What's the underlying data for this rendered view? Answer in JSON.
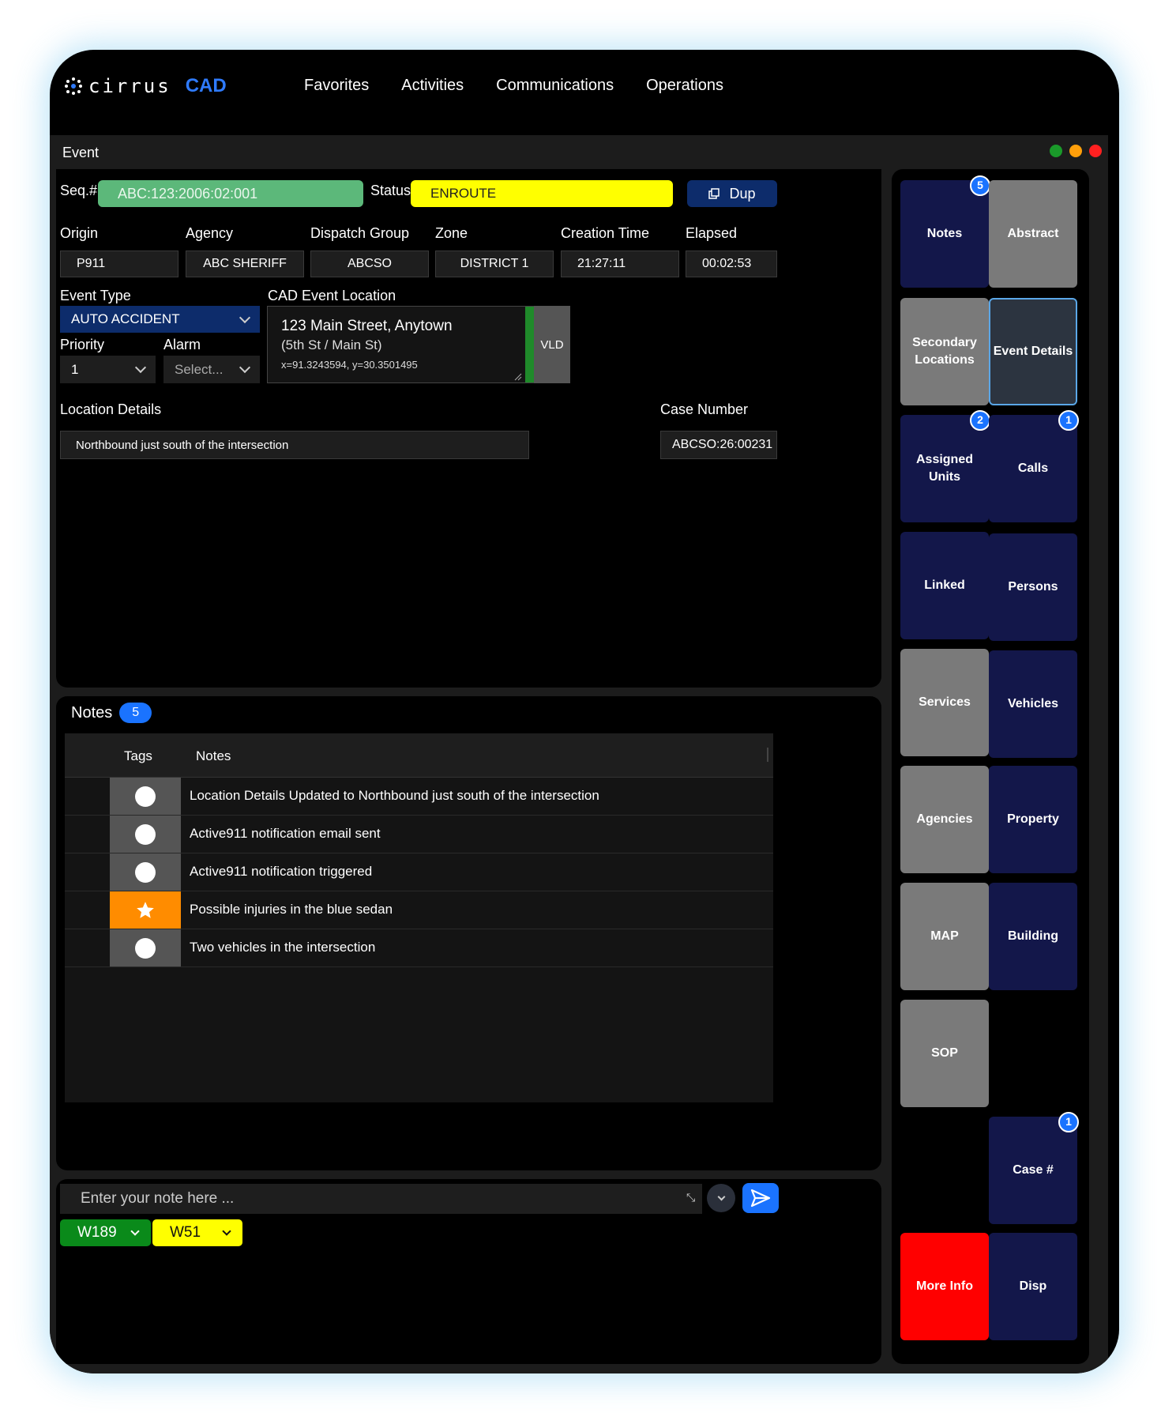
{
  "app": {
    "logo_text": "cirrus",
    "logo_product": "CAD"
  },
  "nav": {
    "items": [
      "Favorites",
      "Activities",
      "Communications",
      "Operations"
    ]
  },
  "window": {
    "title": "Event"
  },
  "event": {
    "seq_label": "Seq.#",
    "seq_value": "ABC:123:2006:02:001",
    "status_label": "Status",
    "status_value": "ENROUTE",
    "dup_label": "Dup",
    "fields": [
      {
        "label": "Origin",
        "value": "P911"
      },
      {
        "label": "Agency",
        "value": "ABC SHERIFF"
      },
      {
        "label": "Dispatch Group",
        "value": "ABCSO"
      },
      {
        "label": "Zone",
        "value": "DISTRICT 1"
      },
      {
        "label": "Creation Time",
        "value": "21:27:11"
      },
      {
        "label": "Elapsed",
        "value": "00:02:53"
      }
    ],
    "event_type_label": "Event Type",
    "event_type_value": "AUTO ACCIDENT",
    "priority_label": "Priority",
    "priority_value": "1",
    "alarm_label": "Alarm",
    "alarm_placeholder": "Select...",
    "location_label": "CAD Event Location",
    "location_line1": "123 Main Street, Anytown",
    "location_line2": "(5th St / Main St)",
    "location_coords": "x=91.3243594, y=30.3501495",
    "vld_label": "VLD",
    "location_details_label": "Location Details",
    "location_details_value": "Northbound just south of the intersection",
    "case_number_label": "Case Number",
    "case_number_value": "ABCSO:26:00231"
  },
  "notes": {
    "title": "Notes",
    "count": "5",
    "col_tags": "Tags",
    "col_notes": "Notes",
    "rows": [
      {
        "tag": "circle",
        "text": "Location Details Updated to Northbound just south of the intersection"
      },
      {
        "tag": "circle",
        "text": "Active911 notification email sent"
      },
      {
        "tag": "circle",
        "text": "Active911 notification triggered"
      },
      {
        "tag": "star",
        "text": "Possible injuries in the blue sedan"
      },
      {
        "tag": "circle",
        "text": "Two vehicles in the intersection"
      }
    ]
  },
  "note_input": {
    "placeholder": "Enter your note here ...",
    "units": [
      {
        "label": "W189",
        "color": "#0a8a1a"
      },
      {
        "label": "W51",
        "color": "#ffff00"
      }
    ]
  },
  "side": {
    "notes": "Notes",
    "notes_badge": "5",
    "abstract": "Abstract",
    "secondary_line1": "Secondary",
    "secondary_line2": "Locations",
    "event_details": "Event Details",
    "assigned_line1": "Assigned",
    "assigned_line2": "Units",
    "assigned_badge": "2",
    "calls": "Calls",
    "calls_badge": "1",
    "linked": "Linked",
    "persons": "Persons",
    "services": "Services",
    "vehicles": "Vehicles",
    "agencies": "Agencies",
    "property": "Property",
    "map": "MAP",
    "building": "Building",
    "sop": "SOP",
    "case": "Case #",
    "case_badge": "1",
    "more_info": "More Info",
    "disp": "Disp"
  },
  "colors": {
    "traffic_green": "#1a9a2a",
    "traffic_yellow": "#ff9f0a",
    "traffic_red": "#ff2020",
    "accent_blue": "#1a73ff",
    "status_yellow": "#ffff00",
    "seq_green": "#5cb87a"
  }
}
